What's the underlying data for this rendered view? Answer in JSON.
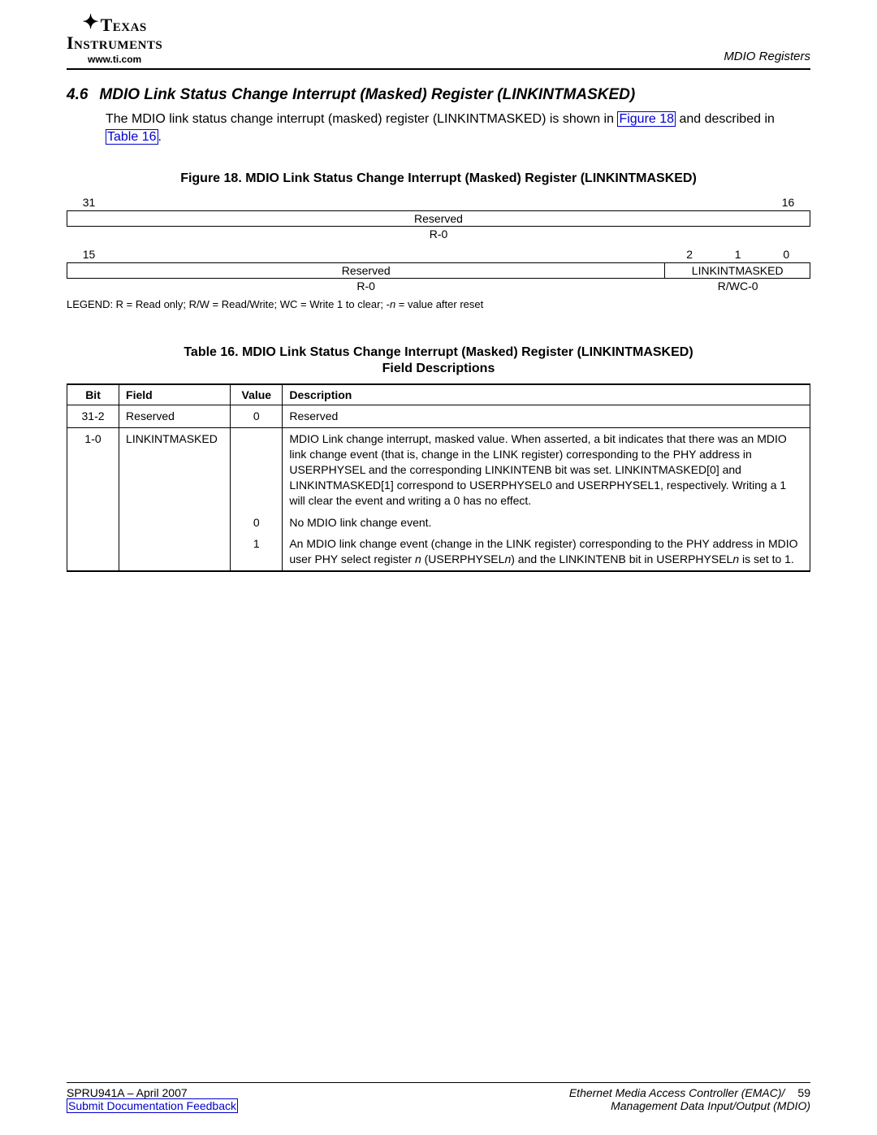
{
  "header": {
    "brand_texas": "Texas",
    "brand_instruments": "Instruments",
    "url": "www.ti.com",
    "section_label": "MDIO Registers"
  },
  "section": {
    "num": "4.6",
    "title": "MDIO Link Status Change Interrupt (Masked) Register (LINKINTMASKED)",
    "body_pre": "The MDIO link status change interrupt (masked) register (LINKINTMASKED) is shown in ",
    "fig_link": "Figure 18",
    "body_mid": " and described in ",
    "tbl_link": "Table 16",
    "body_end": "."
  },
  "figure": {
    "title": "Figure 18. MDIO Link Status Change Interrupt (Masked) Register (LINKINTMASKED)",
    "row1": {
      "bits_left": "31",
      "bits_right": "16",
      "name": "Reserved",
      "access": "R-0"
    },
    "row2": {
      "bits_15": "15",
      "bits_2": "2",
      "bits_1": "1",
      "bits_0": "0",
      "name_a": "Reserved",
      "name_b": "LINKINTMASKED",
      "access_a": "R-0",
      "access_b": "R/WC-0"
    },
    "legend_pre": "LEGEND: R = Read only; R/W = Read/Write; WC = Write 1 to clear; -",
    "legend_n": "n",
    "legend_post": " = value after reset"
  },
  "table": {
    "title_line1": "Table 16. MDIO Link Status Change Interrupt (Masked) Register (LINKINTMASKED)",
    "title_line2": "Field Descriptions",
    "head_bit": "Bit",
    "head_field": "Field",
    "head_value": "Value",
    "head_desc": "Description",
    "r1_bit": "31-2",
    "r1_field": "Reserved",
    "r1_value": "0",
    "r1_desc": "Reserved",
    "r2_bit": "1-0",
    "r2_field": "LINKINTMASKED",
    "r2_desc": "MDIO Link change interrupt, masked value. When asserted, a bit indicates that there was an MDIO link change event (that is, change in the LINK register) corresponding to the PHY address in USERPHYSEL and the corresponding LINKINTENB bit was set. LINKINTMASKED[0] and LINKINTMASKED[1] correspond to USERPHYSEL0 and USERPHYSEL1, respectively. Writing a 1 will clear the event and writing a 0 has no effect.",
    "r3_value": "0",
    "r3_desc": "No MDIO link change event.",
    "r4_value": "1",
    "r4_desc_pre": "An MDIO link change event (change in the LINK register) corresponding to the PHY address in MDIO user PHY select register ",
    "r4_n1": "n",
    "r4_mid": " (USERPHYSEL",
    "r4_n2": "n",
    "r4_mid2": ") and the LINKINTENB bit in USERPHYSEL",
    "r4_n3": "n",
    "r4_end": " is set to 1."
  },
  "footer": {
    "docnum": "SPRU941A – April 2007",
    "feedback": "Submit Documentation Feedback",
    "right1": "Ethernet Media Access Controller (EMAC)/",
    "page": "59",
    "right2": "Management Data Input/Output (MDIO)"
  }
}
